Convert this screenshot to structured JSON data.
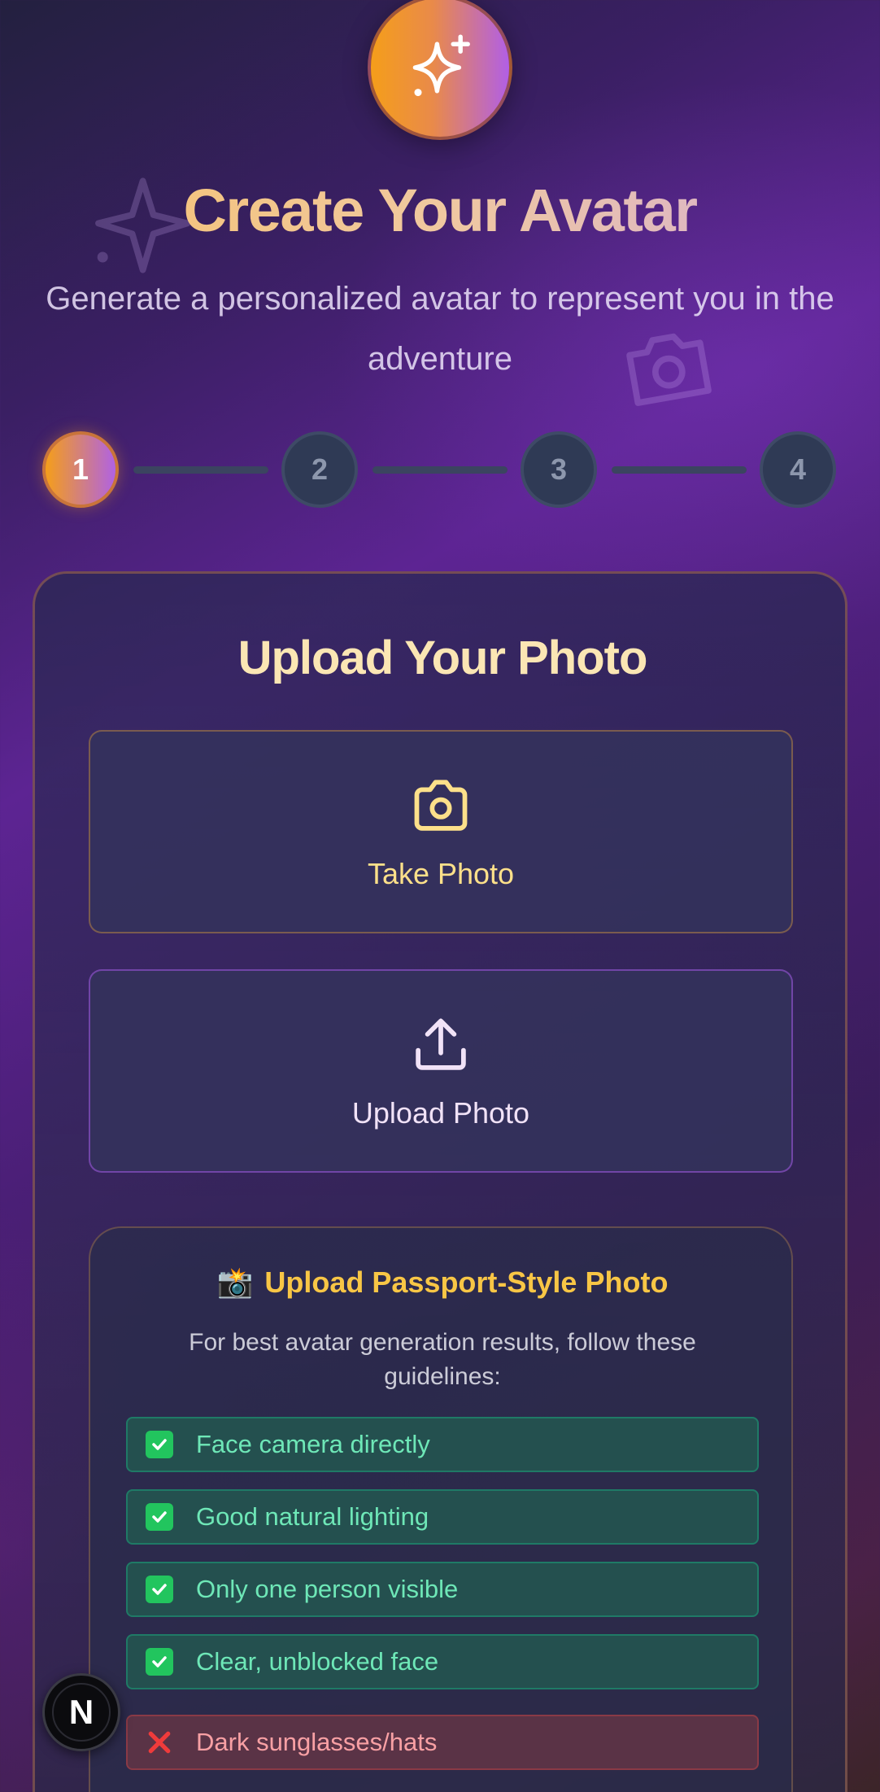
{
  "header": {
    "title": "Create Your Avatar",
    "subtitle": "Generate a personalized avatar to represent you in the adventure"
  },
  "stepper": {
    "current": 1,
    "steps": [
      "1",
      "2",
      "3",
      "4"
    ]
  },
  "upload_card": {
    "title": "Upload Your Photo",
    "take_photo_label": "Take Photo",
    "upload_photo_label": "Upload Photo"
  },
  "guidelines": {
    "title_emoji": "📸",
    "title": "Upload Passport-Style Photo",
    "description": "For best avatar generation results, follow these guidelines:",
    "do_items": [
      "Face camera directly",
      "Good natural lighting",
      "Only one person visible",
      "Clear, unblocked face"
    ],
    "dont_items": [
      "Dark sunglasses/hats"
    ]
  },
  "dev_badge": {
    "letter": "N"
  },
  "colors": {
    "accent_orange": "#f59e1a",
    "accent_purple": "#b062e3",
    "title_cream": "#fbe6b4",
    "guide_gold": "#f8c645",
    "ok_green": "#6ee7b7",
    "bad_red": "#f8a0a4"
  },
  "icons": {
    "logo": "sparkles-icon",
    "take_photo": "camera-icon",
    "upload_photo": "upload-icon",
    "do": "check-box-icon",
    "dont": "cross-icon"
  }
}
